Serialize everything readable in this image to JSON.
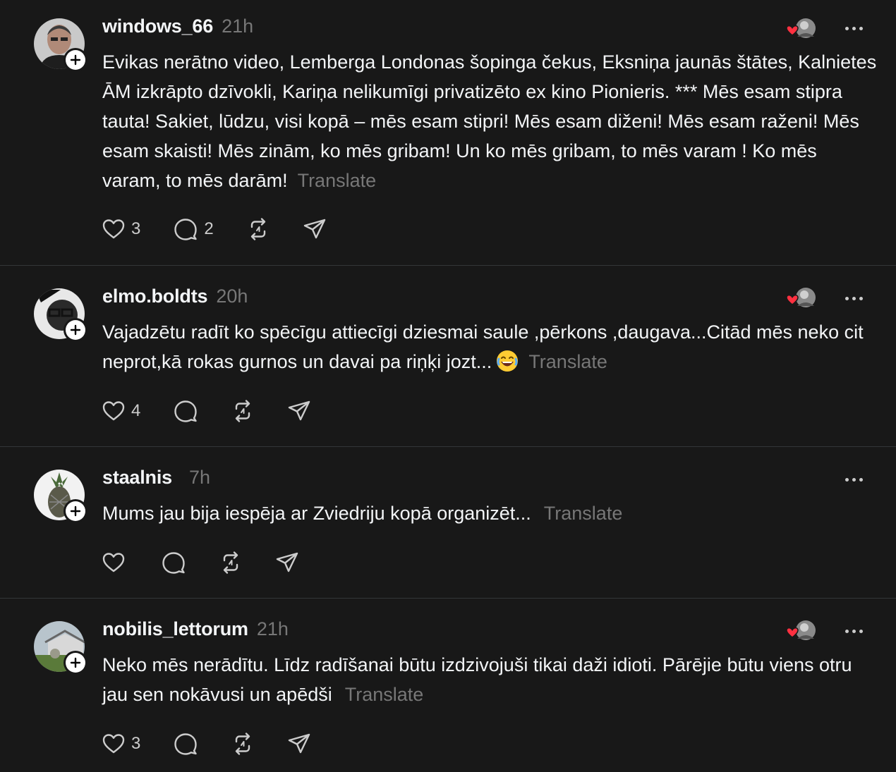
{
  "posts": [
    {
      "username": "windows_66",
      "time": "21h",
      "text": "Evikas nerātno video, Lemberga Londonas šopinga čekus, Eksniņa jaunās štātes, Kalnietes ĀM izkrāpto dzīvokli, Kariņa nelikumīgi privatizēto ex kino Pionieris. *** Mēs esam stipra tauta! Sakiet, lūdzu, visi kopā – mēs esam stipri! Mēs esam diženi! Mēs esam raženi! Mēs esam skaisti! Mēs zinām, ko mēs gribam! Un ko mēs gribam, to mēs varam ! Ko mēs varam, to mēs darām!",
      "translate": "Translate",
      "likes": "3",
      "replies": "2"
    },
    {
      "username": "elmo.boldts",
      "time": "20h",
      "text": "Vajadzētu radīt ko spēcīgu attiecīgi dziesmai saule ,pērkons ,daugava...Citād mēs neko cit neprot,kā rokas gurnos un davai pa riņķi jozt...",
      "translate": "Translate",
      "likes": "4",
      "replies": ""
    },
    {
      "username": "staalnis",
      "time": "7h",
      "text": "Mums jau bija iespēja ar Zviedriju kopā organizēt...",
      "translate": "Translate",
      "likes": "",
      "replies": ""
    },
    {
      "username": "nobilis_lettorum",
      "time": "21h",
      "text": "Neko mēs nerādītu. Līdz radīšanai būtu izdzivojuši tikai daži idioti. Pārējie būtu viens otru jau sen nokāvusi un apēdši",
      "translate": "Translate",
      "likes": "3",
      "replies": ""
    }
  ],
  "colors": {
    "background": "#181818",
    "text": "#f3f5f7",
    "muted": "#777777",
    "divider": "#333638",
    "like_heart": "#ff3040"
  }
}
